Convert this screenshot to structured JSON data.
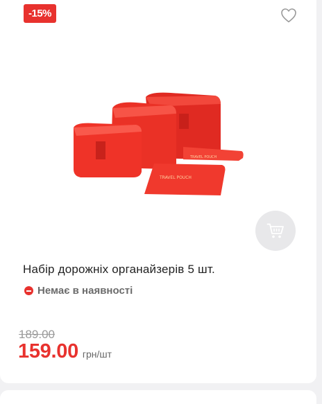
{
  "product": {
    "discount_badge": "-15%",
    "title": "Набір дорожніх органайзерів 5 шт.",
    "availability": "Немає в наявності",
    "old_price": "189.00",
    "price": "159.00",
    "unit": "грн/шт",
    "image_text": "TRAVEL POUCH"
  },
  "icons": {
    "favorite": "heart-outline-icon",
    "cart": "cart-icon",
    "availability": "minus-circle-icon"
  },
  "colors": {
    "accent": "#e8322e",
    "cart_button_bg": "#e8e8ea",
    "product_red": "#f03a2f"
  }
}
